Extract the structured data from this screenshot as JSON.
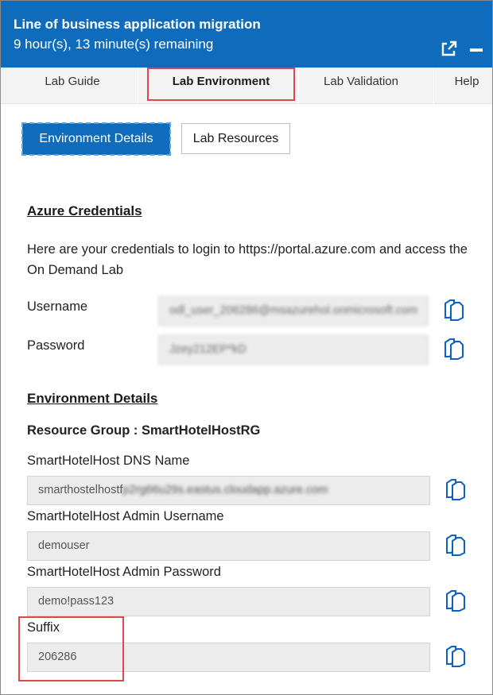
{
  "header": {
    "title": "Line of business application migration",
    "timer": "9 hour(s), 13 minute(s) remaining"
  },
  "tabs": [
    "Lab Guide",
    "Lab Environment",
    "Lab Validation",
    "Help"
  ],
  "buttons": {
    "environment_details": "Environment Details",
    "lab_resources": "Lab Resources"
  },
  "azure": {
    "heading": "Azure Credentials",
    "description": "Here are your credentials to login to https://portal.azure.com and access the On Demand Lab",
    "username_label": "Username",
    "username_value": "odl_user_206286@msazurehol.onmicrosoft.com",
    "password_label": "Password",
    "password_value": "Jzey212EP*kD"
  },
  "environment": {
    "heading": "Environment Details",
    "resource_group": "Resource Group : SmartHotelHostRG",
    "dns_label": "SmartHotelHost DNS Name",
    "dns_value_visible": "smarthostelhostf",
    "dns_value_blurred": "p2rg66u29s.eastus.cloudapp.azure.com",
    "admin_user_label": "SmartHotelHost Admin Username",
    "admin_user_value": "demouser",
    "admin_pass_label": "SmartHotelHost Admin Password",
    "admin_pass_value": "demo!pass123",
    "suffix_label": "Suffix",
    "suffix_value": "206286"
  },
  "colors": {
    "header_bg": "#0f6cbd",
    "highlight_box": "#e0474c",
    "copy_icon": "#1060c0"
  }
}
